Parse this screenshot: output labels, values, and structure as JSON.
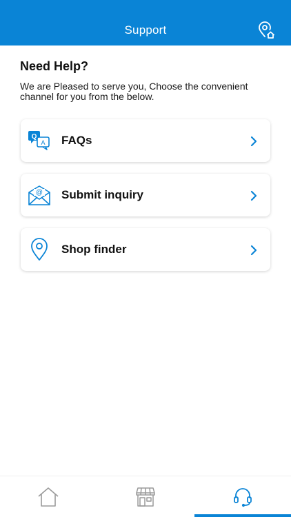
{
  "header": {
    "title": "Support",
    "action_icon": "location-home-icon",
    "color": "#0a84d6"
  },
  "intro": {
    "title": "Need Help?",
    "text": "We are Pleased to serve you, Choose the convenient channel for you from the below."
  },
  "options": [
    {
      "label": "FAQs",
      "icon": "faq-chat-icon"
    },
    {
      "label": "Submit inquiry",
      "icon": "email-icon"
    },
    {
      "label": "Shop finder",
      "icon": "location-pin-icon"
    }
  ],
  "bottom_nav": {
    "items": [
      {
        "icon": "home-icon",
        "active": false
      },
      {
        "icon": "store-icon",
        "active": false
      },
      {
        "icon": "headset-icon",
        "active": true
      }
    ],
    "active_color": "#0a84d6"
  }
}
